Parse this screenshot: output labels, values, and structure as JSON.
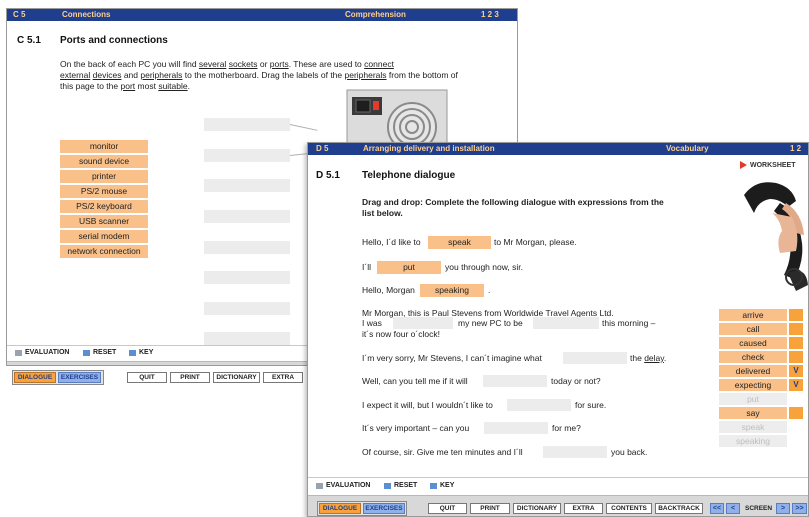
{
  "win1": {
    "header": {
      "section": "C 5",
      "topic": "Connections",
      "type": "Comprehension",
      "pages": "1 2 3"
    },
    "title_num": "C 5.1",
    "title": "Ports and connections",
    "instr": {
      "p1": "On the back of each PC you will find ",
      "w1": "several",
      "p2": " ",
      "w2": "sockets",
      "p3": " or ",
      "w3": "ports",
      "p4": ". These are used to ",
      "w4": "connect",
      "w5": "external",
      "p5": " ",
      "w6": "devices",
      "p6": " and ",
      "w7": "peripherals",
      "p7": " to the motherboard. Drag the labels of the ",
      "w8": "peripherals",
      "p8": " from the bottom of this page to the ",
      "w9": "port",
      "p9": " most ",
      "w10": "suitable",
      "p10": "."
    },
    "labels": [
      "monitor",
      "sound device",
      "printer",
      "PS/2 mouse",
      "PS/2 keyboard",
      "USB scanner",
      "serial modem",
      "network connection"
    ],
    "toolbar": {
      "evaluation": "EVALUATION",
      "reset": "RESET",
      "key": "KEY"
    },
    "footer": {
      "dialogue": "DIALOGUE",
      "exercises": "EXERCISES",
      "quit": "QUIT",
      "print": "PRINT",
      "dictionary": "DICTIONARY",
      "extra": "EXTRA"
    }
  },
  "win2": {
    "header": {
      "section": "D 5",
      "topic": "Arranging delivery and installation",
      "type": "Vocabulary",
      "pages": "1 2"
    },
    "worksheet": "WORKSHEET",
    "title_num": "D 5.1",
    "title": "Telephone dialogue",
    "instruction": "Drag and drop: Complete the following dialogue with expressions from the list below.",
    "lines": {
      "l1a": "Hello, I´d like to",
      "l1fill": "speak",
      "l1b": "to Mr Morgan, please.",
      "l2a": "I´ll",
      "l2fill": "put",
      "l2b": "you through now, sir.",
      "l3a": "Hello, Morgan",
      "l3fill": "speaking",
      "l3b": ".",
      "l4a": "Mr Morgan, this is Paul Stevens from Worldwide Travel Agents Ltd.",
      "l4b": "I was",
      "l4c": "my new PC to be",
      "l4d": "this morning –",
      "l4e": "it´s now four o´clock!",
      "l5a": "I´m very sorry, Mr Stevens, I can´t imagine what",
      "l5b": "the",
      "l5u": "delay",
      "l5c": ".",
      "l6a": "Well, can you tell me if it will",
      "l6b": "today or not?",
      "l7a": "I expect it will, but I wouldn´t like to",
      "l7b": "for sure.",
      "l8a": "It´s very important – can you",
      "l8b": "for me?",
      "l9a": "Of course, sir. Give me ten minutes and I´ll",
      "l9b": "you back."
    },
    "words": [
      {
        "text": "arrive",
        "state": "avail",
        "mark": ""
      },
      {
        "text": "call",
        "state": "avail",
        "mark": ""
      },
      {
        "text": "caused",
        "state": "avail",
        "mark": ""
      },
      {
        "text": "check",
        "state": "avail",
        "mark": ""
      },
      {
        "text": "delivered",
        "state": "avail",
        "mark": "V"
      },
      {
        "text": "expecting",
        "state": "avail",
        "mark": "V"
      },
      {
        "text": "put",
        "state": "used",
        "mark": ""
      },
      {
        "text": "say",
        "state": "avail",
        "mark": ""
      },
      {
        "text": "speak",
        "state": "used",
        "mark": ""
      },
      {
        "text": "speaking",
        "state": "used",
        "mark": ""
      }
    ],
    "toolbar": {
      "evaluation": "EVALUATION",
      "reset": "RESET",
      "key": "KEY"
    },
    "footer": {
      "dialogue": "DIALOGUE",
      "exercises": "EXERCISES",
      "quit": "QUIT",
      "print": "PRINT",
      "dictionary": "DICTIONARY",
      "extra": "EXTRA",
      "contents": "CONTENTS",
      "backtrack": "BACKTRACK",
      "screen": "SCREEN",
      "first": "<<",
      "prev": "<",
      "next": ">",
      "last": ">>"
    }
  }
}
